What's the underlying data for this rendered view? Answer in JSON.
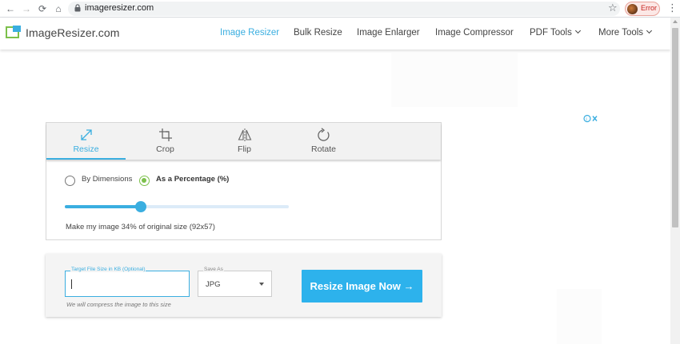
{
  "browser": {
    "url": "imageresizer.com",
    "profile_status": "Error"
  },
  "site": {
    "logo_text": "ImageResizer.com",
    "nav": [
      {
        "label": "Image Resizer",
        "active": true
      },
      {
        "label": "Bulk Resize",
        "active": false
      },
      {
        "label": "Image Enlarger",
        "active": false
      },
      {
        "label": "Image Compressor",
        "active": false
      },
      {
        "label": "PDF Tools",
        "active": false,
        "dropdown": true
      },
      {
        "label": "More Tools",
        "active": false,
        "dropdown": true
      }
    ]
  },
  "tool": {
    "tabs": [
      {
        "label": "Resize",
        "icon": "resize-arrows-icon",
        "active": true
      },
      {
        "label": "Crop",
        "icon": "crop-icon",
        "active": false
      },
      {
        "label": "Flip",
        "icon": "flip-icon",
        "active": false
      },
      {
        "label": "Rotate",
        "icon": "rotate-icon",
        "active": false
      }
    ],
    "mode_options": [
      {
        "label": "By Dimensions",
        "selected": false
      },
      {
        "label": "As a Percentage (%)",
        "selected": true
      }
    ],
    "percentage": 34,
    "size_note": "Make my image  34% of original size (92x57)"
  },
  "export": {
    "target_size_legend": "Target File Size in KB (Optional)",
    "target_size_value": "",
    "save_as_legend": "Save As",
    "save_as_value": "JPG",
    "hint": "We will compress the image to this size",
    "button_label": "Resize Image Now"
  },
  "colors": {
    "accent": "#3aaee0",
    "button": "#2db2ec",
    "radio_selected": "#7cc04b"
  }
}
